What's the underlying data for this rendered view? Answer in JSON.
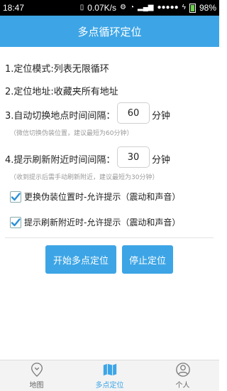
{
  "status_bar": {
    "time": "18:47",
    "speed": "0.07K/s",
    "battery_percent": "98%"
  },
  "header": {
    "title": "多点循环定位"
  },
  "settings": {
    "mode_line": "1.定位模式:列表无限循环",
    "address_line": "2.定位地址:收藏夹所有地址",
    "switch_interval_label": "3.自动切换地点时间间隔：",
    "switch_interval_value": "60",
    "switch_interval_unit": "分钟",
    "switch_interval_hint": "（微信切换伪装位置，建议最短为60分钟）",
    "refresh_interval_label": "4.提示刷新附近时间间隔：",
    "refresh_interval_value": "30",
    "refresh_interval_unit": "分钟",
    "refresh_interval_hint": "（收到提示后需手动刷新附近，建议最短为30分钟）",
    "check_change_location": "更换伪装位置时-允许提示（震动和声音）",
    "check_refresh_nearby": "提示刷新附近时-允许提示（震动和声音）"
  },
  "buttons": {
    "start": "开始多点定位",
    "stop": "停止定位"
  },
  "tabs": [
    {
      "label": "地图",
      "icon": "map-pin-icon",
      "active": false
    },
    {
      "label": "多点定位",
      "icon": "map-icon",
      "active": true
    },
    {
      "label": "个人",
      "icon": "person-icon",
      "active": false
    }
  ],
  "colors": {
    "accent": "#3da5e6",
    "check": "#2a8fd8"
  }
}
